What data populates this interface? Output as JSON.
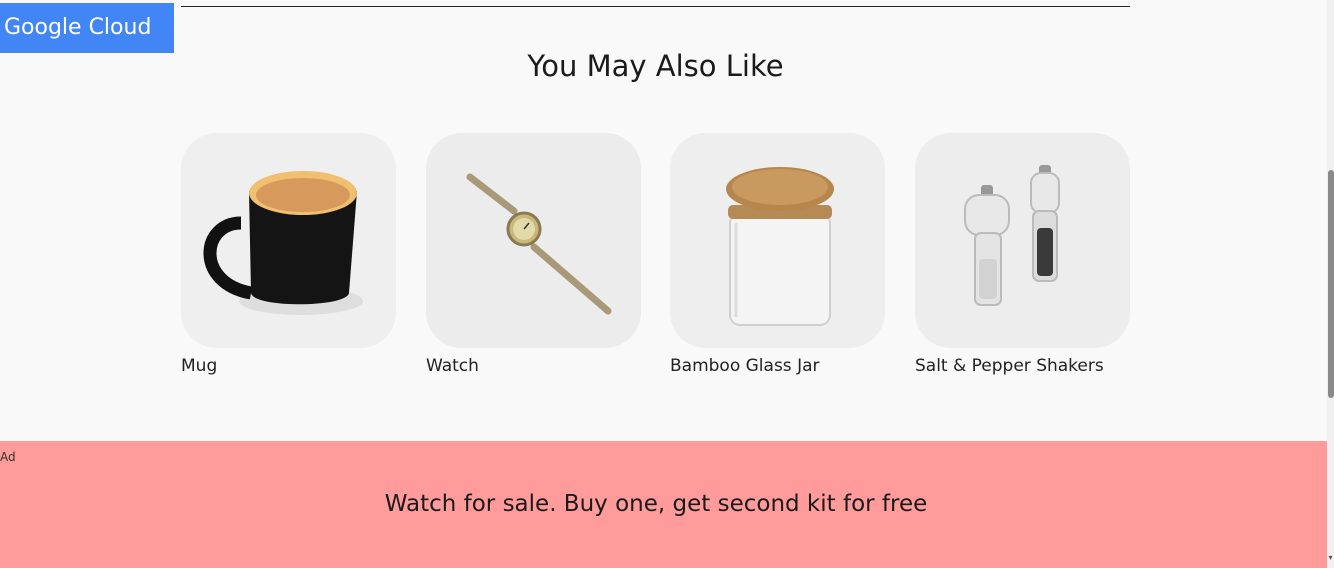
{
  "brand": {
    "label": "Google Cloud",
    "color": "#4285f4"
  },
  "recommendations": {
    "title": "You May Also Like",
    "products": [
      {
        "name": "Mug",
        "icon": "mug-photo"
      },
      {
        "name": "Watch",
        "icon": "watch-photo"
      },
      {
        "name": "Bamboo Glass Jar",
        "icon": "jar-photo"
      },
      {
        "name": "Salt & Pepper Shakers",
        "icon": "shakers-photo"
      }
    ]
  },
  "ad": {
    "label": "Ad",
    "text": "Watch for sale. Buy one, get second kit for free",
    "background": "#ff9b9b"
  },
  "colors": {
    "page_background": "#f9f9f9",
    "tile_background": "#ececec"
  }
}
